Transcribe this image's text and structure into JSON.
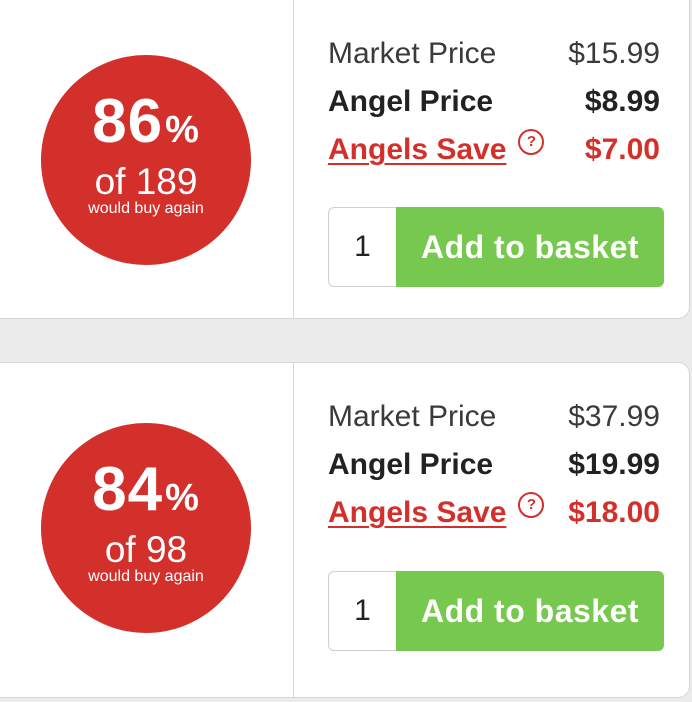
{
  "products": [
    {
      "badge": {
        "percent": "86",
        "percent_sign": "%",
        "of_text": "of 189",
        "subtitle": "would buy again"
      },
      "market_price_label": "Market Price",
      "market_price": "$15.99",
      "angel_price_label": "Angel Price",
      "angel_price": "$8.99",
      "angels_save_label": "Angels Save",
      "angels_save_help_icon": "?",
      "angels_save": "$7.00",
      "quantity": "1",
      "add_to_basket_label": "Add to basket"
    },
    {
      "badge": {
        "percent": "84",
        "percent_sign": "%",
        "of_text": "of 98",
        "subtitle": "would buy again"
      },
      "market_price_label": "Market Price",
      "market_price": "$37.99",
      "angel_price_label": "Angel Price",
      "angel_price": "$19.99",
      "angels_save_label": "Angels Save",
      "angels_save_help_icon": "?",
      "angels_save": "$18.00",
      "quantity": "1",
      "add_to_basket_label": "Add to basket"
    }
  ],
  "colors": {
    "badge_red": "#d3302c",
    "save_red": "#d3302c",
    "button_green": "#77c84f",
    "page_background": "#ebebeb"
  },
  "icons": {
    "help": "question-circle-icon"
  }
}
